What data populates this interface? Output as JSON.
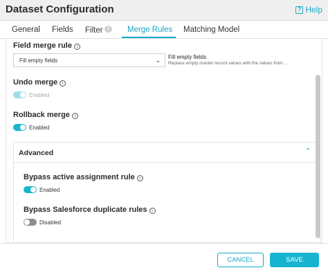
{
  "dialog": {
    "title": "Dataset Configuration",
    "help_label": "Help"
  },
  "tabs": [
    {
      "label": "General"
    },
    {
      "label": "Fields"
    },
    {
      "label": "Filter",
      "badge": "0"
    },
    {
      "label": "Merge Rules",
      "active": true
    },
    {
      "label": "Matching Model"
    }
  ],
  "merge": {
    "field_merge_rule": {
      "label": "Field merge rule",
      "selected": "Fill empty fields",
      "option_title": "Fill empty fields",
      "option_desc": "Replace empty master record values with the values from..."
    },
    "undo_merge": {
      "label": "Undo merge",
      "state": "Enabled",
      "on": true,
      "disabled": true
    },
    "rollback_merge": {
      "label": "Rollback merge",
      "state": "Enabled",
      "on": true
    }
  },
  "advanced": {
    "title": "Advanced",
    "expanded": true,
    "bypass_assignment": {
      "label": "Bypass active assignment rule",
      "state": "Enabled",
      "on": true
    },
    "bypass_duplicate": {
      "label": "Bypass Salesforce duplicate rules",
      "state": "Disabled",
      "on": false
    }
  },
  "footer": {
    "cancel_label": "CANCEL",
    "save_label": "SAVE"
  },
  "colors": {
    "accent": "#17a9c9",
    "toggle_on": "#1ab4cf",
    "toggle_off": "#8e8e8e"
  }
}
